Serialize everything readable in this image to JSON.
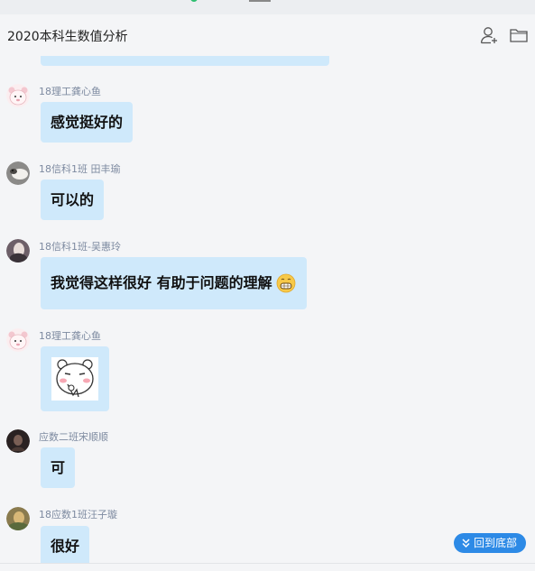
{
  "header": {
    "title": "2020本科生数值分析",
    "icons": [
      "add-member-icon",
      "folder-icon"
    ]
  },
  "messages": [
    {
      "sender": "18理工龚心鱼",
      "text": "感觉挺好的"
    },
    {
      "sender": "18信科1班 田丰瑜",
      "text": "可以的"
    },
    {
      "sender": "18信科1班-吴惠玲",
      "text": "我觉得这样很好 有助于问题的理解"
    },
    {
      "sender": "18理工龚心鱼",
      "text": ""
    },
    {
      "sender": "应数二班宋顺顺",
      "text": "可"
    },
    {
      "sender": "18应数1班汪子璇",
      "text": "很好"
    }
  ],
  "scroll_bottom_button": {
    "label": "回到底部"
  },
  "colors": {
    "bubble": "#cfe9fb",
    "sender_name": "#7d8aa0",
    "accent_button": "#2d8ae6"
  }
}
